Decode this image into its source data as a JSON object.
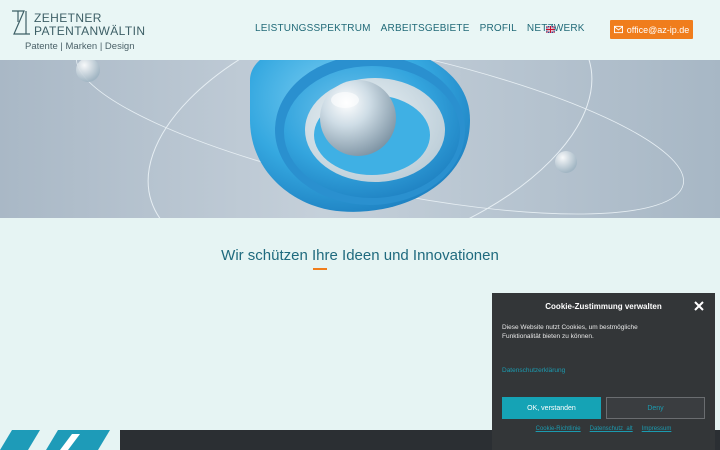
{
  "header": {
    "logo": {
      "line1": "ZEHETNER",
      "line2": "PATENTANWÄLTIN",
      "subtitle": "Patente | Marken | Design"
    },
    "nav": [
      {
        "label": "LEISTUNGSSPEKTRUM"
      },
      {
        "label": "ARBEITSGEBIETE"
      },
      {
        "label": "PROFIL"
      },
      {
        "label": "NETZWERK"
      }
    ],
    "language_icon": "uk-flag-icon",
    "email_button": {
      "label": "office@az-ip.de",
      "icon": "envelope-icon"
    }
  },
  "main": {
    "tagline": "Wir schützen Ihre Ideen und Innovationen"
  },
  "cookie_banner": {
    "title": "Cookie-Zustimmung verwalten",
    "text": "Diese Website nutzt Cookies, um bestmögliche Funktionalität bieten zu können.",
    "privacy_link": "Datenschutzerklärung",
    "accept_label": "OK, verstanden",
    "deny_label": "Deny",
    "footer_links": [
      "Cookie-Richtlinie",
      "Datenschutz_alt",
      "Impressum"
    ]
  },
  "colors": {
    "accent": "#f07d1c",
    "primary": "#216a78",
    "teal_button": "#15a3b5",
    "banner_bg": "#333638"
  }
}
